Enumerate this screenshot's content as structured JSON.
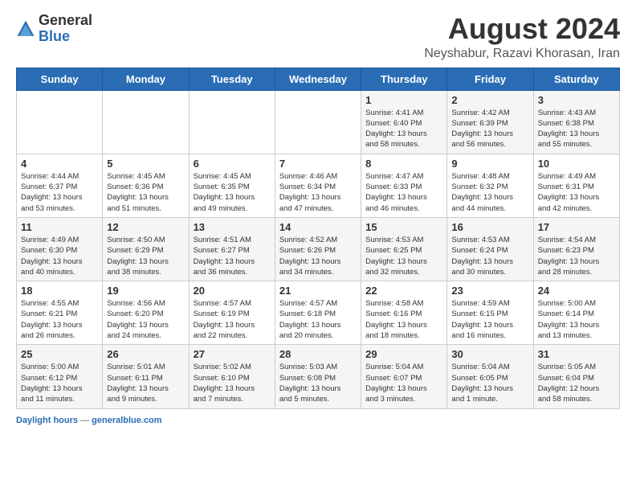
{
  "header": {
    "logo_general": "General",
    "logo_blue": "Blue",
    "month_year": "August 2024",
    "location": "Neyshabur, Razavi Khorasan, Iran"
  },
  "weekdays": [
    "Sunday",
    "Monday",
    "Tuesday",
    "Wednesday",
    "Thursday",
    "Friday",
    "Saturday"
  ],
  "weeks": [
    [
      {
        "day": "",
        "info": ""
      },
      {
        "day": "",
        "info": ""
      },
      {
        "day": "",
        "info": ""
      },
      {
        "day": "",
        "info": ""
      },
      {
        "day": "1",
        "info": "Sunrise: 4:41 AM\nSunset: 6:40 PM\nDaylight: 13 hours\nand 58 minutes."
      },
      {
        "day": "2",
        "info": "Sunrise: 4:42 AM\nSunset: 6:39 PM\nDaylight: 13 hours\nand 56 minutes."
      },
      {
        "day": "3",
        "info": "Sunrise: 4:43 AM\nSunset: 6:38 PM\nDaylight: 13 hours\nand 55 minutes."
      }
    ],
    [
      {
        "day": "4",
        "info": "Sunrise: 4:44 AM\nSunset: 6:37 PM\nDaylight: 13 hours\nand 53 minutes."
      },
      {
        "day": "5",
        "info": "Sunrise: 4:45 AM\nSunset: 6:36 PM\nDaylight: 13 hours\nand 51 minutes."
      },
      {
        "day": "6",
        "info": "Sunrise: 4:45 AM\nSunset: 6:35 PM\nDaylight: 13 hours\nand 49 minutes."
      },
      {
        "day": "7",
        "info": "Sunrise: 4:46 AM\nSunset: 6:34 PM\nDaylight: 13 hours\nand 47 minutes."
      },
      {
        "day": "8",
        "info": "Sunrise: 4:47 AM\nSunset: 6:33 PM\nDaylight: 13 hours\nand 46 minutes."
      },
      {
        "day": "9",
        "info": "Sunrise: 4:48 AM\nSunset: 6:32 PM\nDaylight: 13 hours\nand 44 minutes."
      },
      {
        "day": "10",
        "info": "Sunrise: 4:49 AM\nSunset: 6:31 PM\nDaylight: 13 hours\nand 42 minutes."
      }
    ],
    [
      {
        "day": "11",
        "info": "Sunrise: 4:49 AM\nSunset: 6:30 PM\nDaylight: 13 hours\nand 40 minutes."
      },
      {
        "day": "12",
        "info": "Sunrise: 4:50 AM\nSunset: 6:29 PM\nDaylight: 13 hours\nand 38 minutes."
      },
      {
        "day": "13",
        "info": "Sunrise: 4:51 AM\nSunset: 6:27 PM\nDaylight: 13 hours\nand 36 minutes."
      },
      {
        "day": "14",
        "info": "Sunrise: 4:52 AM\nSunset: 6:26 PM\nDaylight: 13 hours\nand 34 minutes."
      },
      {
        "day": "15",
        "info": "Sunrise: 4:53 AM\nSunset: 6:25 PM\nDaylight: 13 hours\nand 32 minutes."
      },
      {
        "day": "16",
        "info": "Sunrise: 4:53 AM\nSunset: 6:24 PM\nDaylight: 13 hours\nand 30 minutes."
      },
      {
        "day": "17",
        "info": "Sunrise: 4:54 AM\nSunset: 6:23 PM\nDaylight: 13 hours\nand 28 minutes."
      }
    ],
    [
      {
        "day": "18",
        "info": "Sunrise: 4:55 AM\nSunset: 6:21 PM\nDaylight: 13 hours\nand 26 minutes."
      },
      {
        "day": "19",
        "info": "Sunrise: 4:56 AM\nSunset: 6:20 PM\nDaylight: 13 hours\nand 24 minutes."
      },
      {
        "day": "20",
        "info": "Sunrise: 4:57 AM\nSunset: 6:19 PM\nDaylight: 13 hours\nand 22 minutes."
      },
      {
        "day": "21",
        "info": "Sunrise: 4:57 AM\nSunset: 6:18 PM\nDaylight: 13 hours\nand 20 minutes."
      },
      {
        "day": "22",
        "info": "Sunrise: 4:58 AM\nSunset: 6:16 PM\nDaylight: 13 hours\nand 18 minutes."
      },
      {
        "day": "23",
        "info": "Sunrise: 4:59 AM\nSunset: 6:15 PM\nDaylight: 13 hours\nand 16 minutes."
      },
      {
        "day": "24",
        "info": "Sunrise: 5:00 AM\nSunset: 6:14 PM\nDaylight: 13 hours\nand 13 minutes."
      }
    ],
    [
      {
        "day": "25",
        "info": "Sunrise: 5:00 AM\nSunset: 6:12 PM\nDaylight: 13 hours\nand 11 minutes."
      },
      {
        "day": "26",
        "info": "Sunrise: 5:01 AM\nSunset: 6:11 PM\nDaylight: 13 hours\nand 9 minutes."
      },
      {
        "day": "27",
        "info": "Sunrise: 5:02 AM\nSunset: 6:10 PM\nDaylight: 13 hours\nand 7 minutes."
      },
      {
        "day": "28",
        "info": "Sunrise: 5:03 AM\nSunset: 6:08 PM\nDaylight: 13 hours\nand 5 minutes."
      },
      {
        "day": "29",
        "info": "Sunrise: 5:04 AM\nSunset: 6:07 PM\nDaylight: 13 hours\nand 3 minutes."
      },
      {
        "day": "30",
        "info": "Sunrise: 5:04 AM\nSunset: 6:05 PM\nDaylight: 13 hours\nand 1 minute."
      },
      {
        "day": "31",
        "info": "Sunrise: 5:05 AM\nSunset: 6:04 PM\nDaylight: 12 hours\nand 58 minutes."
      }
    ]
  ],
  "footer": {
    "label": "Daylight hours",
    "source": "generalblue.com"
  }
}
